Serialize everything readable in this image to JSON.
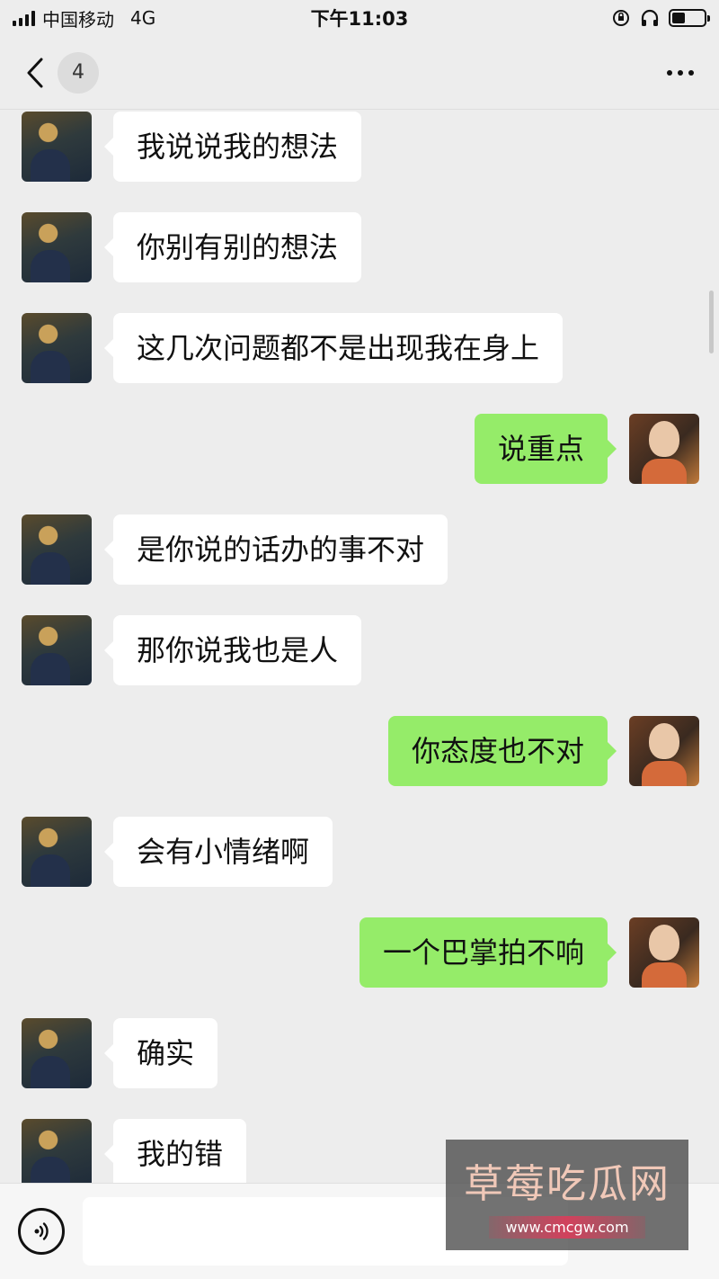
{
  "status_bar": {
    "carrier": "中国移动",
    "network": "4G",
    "time": "下午11:03"
  },
  "nav": {
    "unread_count": "4"
  },
  "messages": [
    {
      "side": "left",
      "text": "我说说我的想法"
    },
    {
      "side": "left",
      "text": "你别有别的想法"
    },
    {
      "side": "left",
      "text": "这几次问题都不是出现我在身上"
    },
    {
      "side": "right",
      "text": "说重点"
    },
    {
      "side": "left",
      "text": "是你说的话办的事不对"
    },
    {
      "side": "left",
      "text": "那你说我也是人"
    },
    {
      "side": "right",
      "text": "你态度也不对"
    },
    {
      "side": "left",
      "text": "会有小情绪啊"
    },
    {
      "side": "right",
      "text": "一个巴掌拍不响"
    },
    {
      "side": "left",
      "text": "确实"
    },
    {
      "side": "left",
      "text": "我的错"
    }
  ],
  "input": {
    "value": ""
  },
  "watermark": {
    "title": "草莓吃瓜网",
    "url": "www.cmcgw.com"
  },
  "colors": {
    "background": "#ededed",
    "sent_bubble": "#95ec69",
    "received_bubble": "#ffffff"
  }
}
